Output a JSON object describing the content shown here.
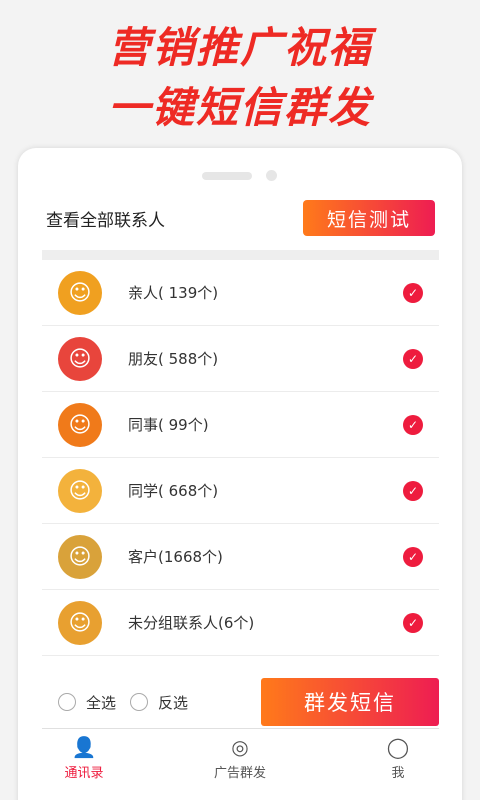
{
  "promo": {
    "line1": "营销推广祝福",
    "line2": "一键短信群发"
  },
  "screen": {
    "title": "查看全部联系人",
    "test_button": "短信测试"
  },
  "groups": [
    {
      "label": "亲人( 139个)",
      "avatar_icon": "family-group-icon",
      "avatar_color": "#f0a020",
      "checked": true
    },
    {
      "label": "朋友( 588个)",
      "avatar_icon": "friend-waving-icon",
      "avatar_color": "#e8453c",
      "checked": true
    },
    {
      "label": "同事(  99个)",
      "avatar_icon": "colleague-icon",
      "avatar_color": "#f07a1a",
      "checked": true
    },
    {
      "label": "同学( 668个)",
      "avatar_icon": "classmate-icon",
      "avatar_color": "#f3b23c",
      "checked": true
    },
    {
      "label": "客户(1668个)",
      "avatar_icon": "client-money-icon",
      "avatar_color": "#d9a23a",
      "checked": true
    },
    {
      "label": "未分组联系人(6个)",
      "avatar_icon": "ungrouped-person-icon",
      "avatar_color": "#e8a030",
      "checked": true
    }
  ],
  "actions": {
    "select_all": "全选",
    "invert": "反选",
    "send": "群发短信"
  },
  "tabs": [
    {
      "label": "通讯录",
      "icon": "contacts-icon",
      "active": true
    },
    {
      "label": "广告群发",
      "icon": "compass-icon",
      "active": false
    },
    {
      "label": "我",
      "icon": "person-icon",
      "active": false
    }
  ],
  "colors": {
    "accent": "#ee1c3e",
    "accent_orange": "#ff7a1a",
    "headline": "#ee2a24"
  }
}
